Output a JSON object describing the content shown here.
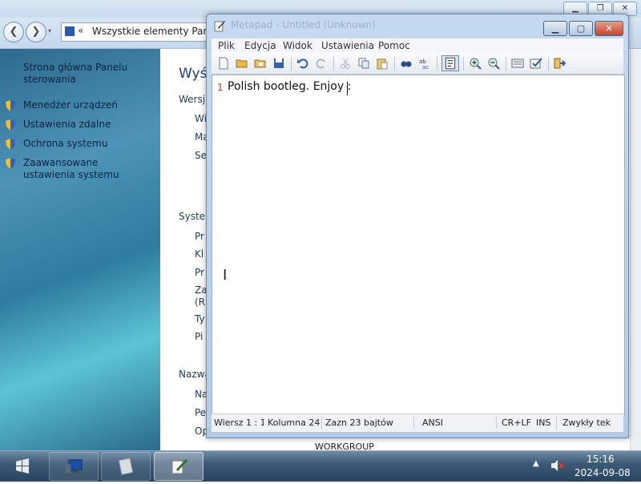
{
  "background_window": {
    "address": "Wszystkie elementy Panelu",
    "address_chevrons": "«",
    "sidebar": {
      "home": "Strona główna Panelu sterowania",
      "items": [
        {
          "label": "Menedżer urządzeń"
        },
        {
          "label": "Ustawienia zdalne"
        },
        {
          "label": "Ochrona systemu"
        },
        {
          "label": "Zaawansowane ustawienia systemu"
        }
      ]
    },
    "main": {
      "heading": "Wyś",
      "fragments": [
        "Wersja",
        "Wi",
        "Ma",
        "Se",
        "System",
        "Pr",
        "Kl",
        "Pr",
        "Za",
        "(R",
        "Ty",
        "Pi",
        "Nazwa",
        "Na",
        "Pe",
        "Op"
      ],
      "workgroup": "WORKGROUP"
    }
  },
  "notepad": {
    "title": "Metapad - Untitled (Unknown)",
    "menu": [
      "Plik",
      "Edycja",
      "Widok",
      "Ustawienia",
      "Pomoc"
    ],
    "line_number": "1",
    "content": "Polish bootleg. Enjoy :",
    "status": {
      "position": "Wiersz 1 : 1",
      "column": "Kolumna 24",
      "selection": "Zazn 23 bajtów",
      "encoding": "ANSI",
      "line_ending": "CR+LF",
      "mode": "INS",
      "text_mode": "Zwykły teks"
    }
  },
  "taskbar": {
    "tray_arrow": "▲",
    "time": "15:16",
    "date": "2024-09-08"
  },
  "colors": {
    "taskbar": "#3d5a76",
    "close_button": "#c2452c",
    "line_number": "#b04020"
  }
}
